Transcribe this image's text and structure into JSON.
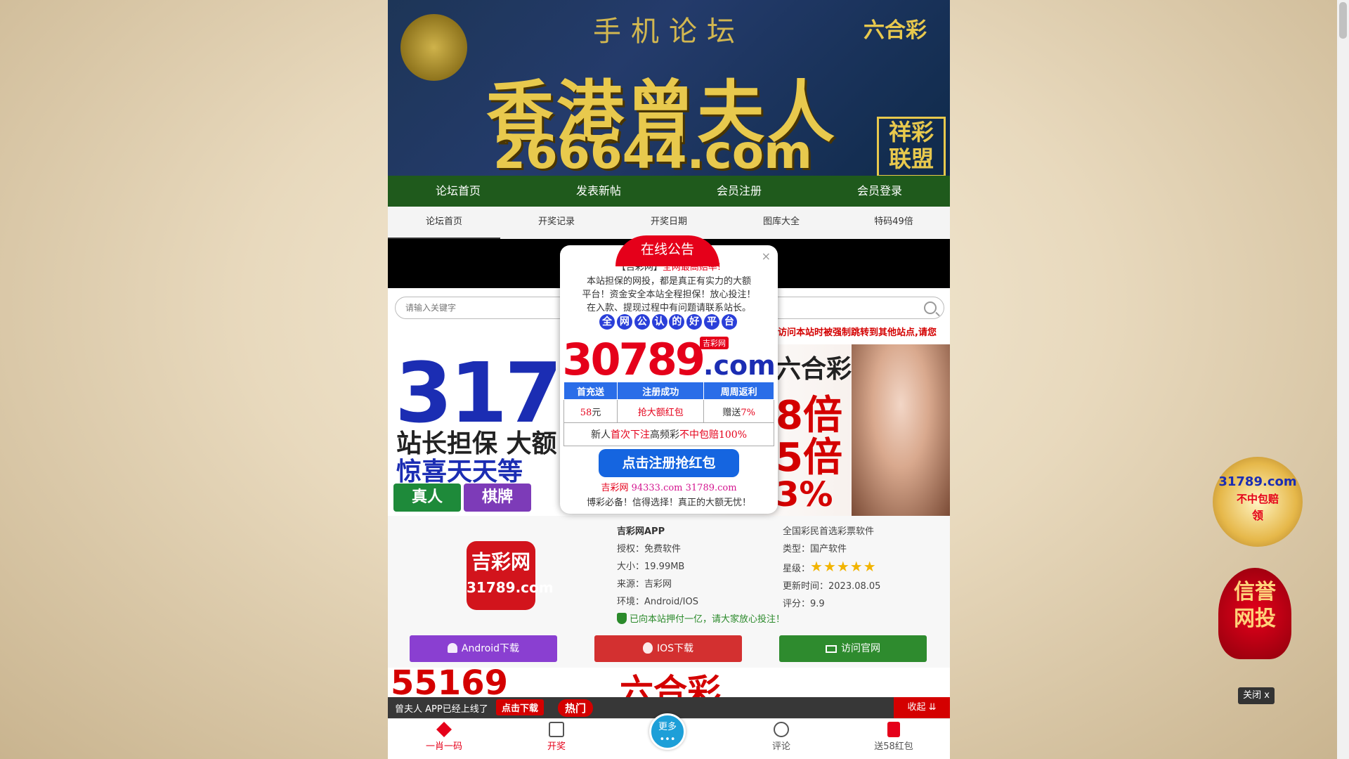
{
  "banner": {
    "forum_label": "手机论坛",
    "title": "香港曾夫人",
    "domain": "266644.com",
    "brand": "六合彩",
    "badge": "祥彩联盟"
  },
  "nav_main": [
    "论坛首页",
    "发表新帖",
    "会员注册",
    "会员登录"
  ],
  "nav_tabs": [
    "论坛首页",
    "开奖记录",
    "开奖日期",
    "图库大全",
    "特码49倍"
  ],
  "search": {
    "placeholder": "请输入关键字"
  },
  "notice_red": "访问本站时被强制跳转到其他站点,请您",
  "ad_banner": {
    "big_number": "31789",
    "line1": "站长担保 大额",
    "line2": "惊喜天天等",
    "chips": [
      "真人",
      "棋牌"
    ],
    "right_title": "六合彩",
    "right_row1": "8倍",
    "right_row2": "5倍",
    "right_row3": "3%"
  },
  "app": {
    "logo_line1": "吉彩网",
    "logo_line2": "31789.com",
    "name": "吉彩网APP",
    "license": "授权：免费软件",
    "size": "大小：19.99MB",
    "source": "来源：吉彩网",
    "env": "环境：Android/IOS",
    "tagline": "全国彩民首选彩票软件",
    "type": "类型：国产软件",
    "rating_label": "星级：",
    "stars": "★★★★★",
    "updated": "更新时间：2023.08.05",
    "score": "评分：9.9",
    "guarantee": "已向本站押付一亿，请大家放心投注！",
    "btn_android": "Android下载",
    "btn_ios": "IOS下载",
    "btn_site": "访问官网",
    "colors": {
      "android": "#8a3fd1",
      "ios": "#d33030",
      "site": "#2e8b2e"
    }
  },
  "bottom_ad": {
    "left": "55169",
    "right": "六合彩"
  },
  "app_bar": {
    "message": "曾夫人 APP已经上线了",
    "download": "点击下载",
    "hot": "热门",
    "fold": "收起 ⇊"
  },
  "tab_bar": {
    "tab1": "一肖一码",
    "tab2": "开奖",
    "more_line1": "更多",
    "more_line2": "•••",
    "tab4": "评论",
    "tab5": "送58红包"
  },
  "modal": {
    "header": "在线公告",
    "close": "×",
    "line1a": "【吉彩网】",
    "line1b": "全网最高赔率!",
    "line2": "本站担保的网投，都是真正有实力的大额",
    "line3": "平台！资金安全本站全程担保！放心投注！",
    "line4": "在入款、提现过程中有问题请联系站长。",
    "slogan": [
      "全",
      "网",
      "公",
      "认",
      "的",
      "好",
      "平",
      "台"
    ],
    "domain_red": "30789",
    "domain_blue": ".com",
    "tag": "吉彩网",
    "table_headers": [
      "首充送",
      "注册成功",
      "周周返利"
    ],
    "row1": {
      "c1a": "58",
      "c1b": "元",
      "c2": "抢大额红包",
      "c3a": "赠送",
      "c3b": "7%"
    },
    "row2": {
      "a": "新人",
      "b": "首次下注",
      "c": "高频彩",
      "d": "不中包赔100%"
    },
    "button": "点击注册抢红包",
    "sites_a": "吉彩网",
    "sites_b": " 94333.com 31789.com",
    "footer": "博彩必备！信得选择！真正的大额无忧！"
  },
  "side": {
    "badge1_line1": "31789.com",
    "badge1_line2": "不中包赔",
    "badge1_line3": "领",
    "badge2_line1": "信誉",
    "badge2_line2": "网投",
    "close": "关闭 x"
  }
}
